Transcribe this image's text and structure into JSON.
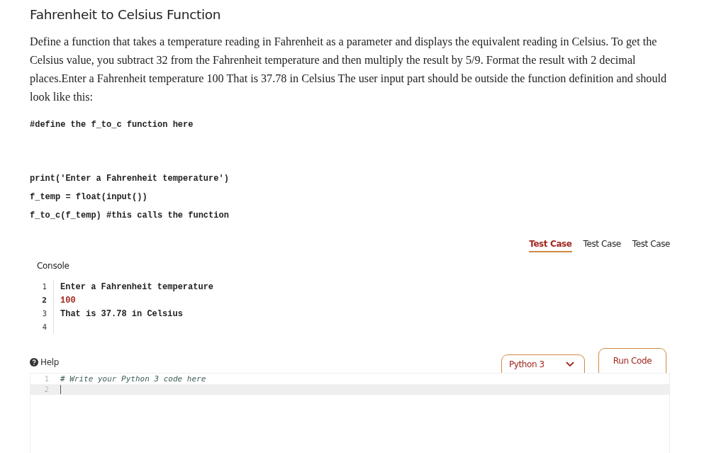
{
  "title": "Fahrenheit to Celsius Function",
  "description": "Define a function that takes a temperature reading in Fahrenheit as a parameter and displays the equivalent reading in Celsius. To get the Celsius value, you subtract 32 from the Fahrenheit temperature and then multiply the result by 5/9. Format the result with 2 decimal places.Enter a Fahrenheit temperature 100 That is 37.78 in Celsius The user input part should be outside the function definition and should look like this:",
  "code_sample": [
    {
      "lines": [
        "#define the f_to_c function here"
      ]
    },
    {
      "lines": [
        "print('Enter a Fahrenheit temperature')",
        "f_temp = float(input())",
        "f_to_c(f_temp) #this calls the function"
      ]
    }
  ],
  "tabs": [
    {
      "label": "Test Case",
      "selected": true
    },
    {
      "label": "Test Case",
      "selected": false
    },
    {
      "label": "Test Case",
      "selected": false
    }
  ],
  "console": {
    "label": "Console",
    "lines": [
      {
        "number": "1",
        "text": "Enter a Fahrenheit temperature",
        "kind": "output"
      },
      {
        "number": "2",
        "text": "100",
        "kind": "input"
      },
      {
        "number": "3",
        "text": "That is 37.78 in Celsius",
        "kind": "output"
      },
      {
        "number": "4"
      }
    ]
  },
  "help": {
    "label": "Help"
  },
  "language": {
    "value": "Python 3"
  },
  "run_button": {
    "label": "Run Code"
  },
  "editor": {
    "lines": [
      {
        "number": "1",
        "text": "# Write your Python 3 code here",
        "kind": "comment",
        "active": false
      },
      {
        "number": "2",
        "active": true
      }
    ]
  }
}
